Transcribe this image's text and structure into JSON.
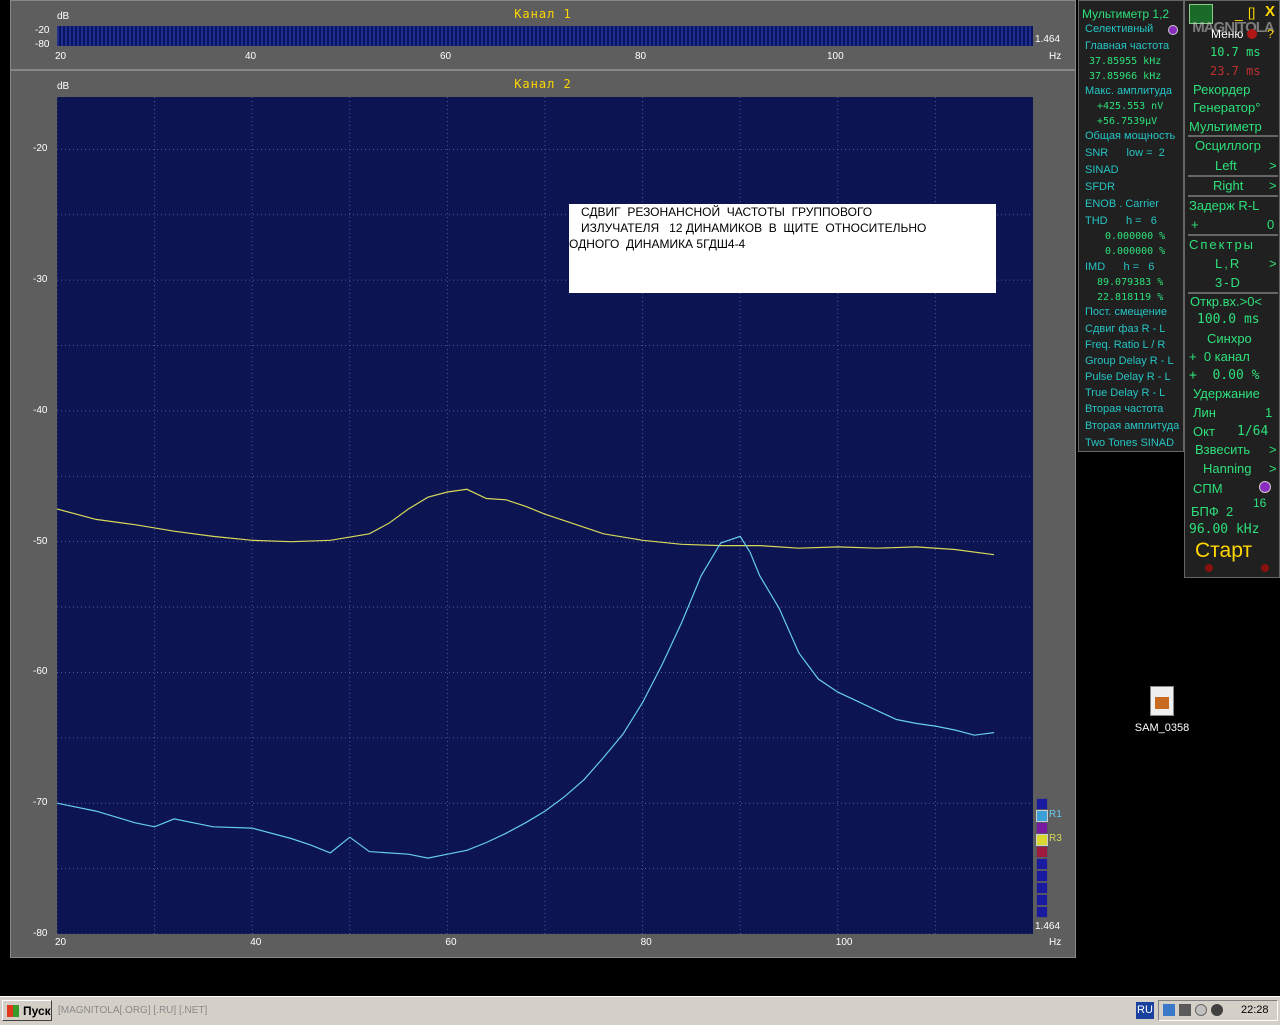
{
  "channel1": {
    "title": "Канал 1",
    "db_label": "dB",
    "y_ticks": [
      "-20",
      "-80"
    ],
    "x_ticks": [
      "20",
      "40",
      "60",
      "80",
      "100"
    ],
    "x_unit": "Hz",
    "scale_value": "1.464"
  },
  "channel2": {
    "title": "Канал 2",
    "db_label": "dB",
    "scale_value": "1.464",
    "annotation": [
      "СДВИГ  РЕЗОНАНСНОЙ  ЧАСТОТЫ  ГРУППОВОГО",
      "ИЗЛУЧАТЕЛЯ   12 ДИНАМИКОВ  В  ЩИТЕ  ОТНОСИТЕЛЬНО",
      "ОДНОГО  ДИНАМИКА 5ГДШ4-4"
    ],
    "legend_labels": [
      "R1",
      "R3"
    ]
  },
  "chart_data": {
    "type": "line",
    "xlabel": "Hz",
    "ylabel": "dB",
    "xlim": [
      20,
      118
    ],
    "ylim": [
      -80,
      -16
    ],
    "x_ticks": [
      20,
      40,
      60,
      80,
      100
    ],
    "y_ticks": [
      -20,
      -30,
      -40,
      -50,
      -60,
      -70,
      -80
    ],
    "grid": true,
    "series": [
      {
        "name": "R3",
        "color": "#d8d85a",
        "x": [
          20,
          24,
          28,
          32,
          36,
          40,
          44,
          48,
          52,
          54,
          56,
          58,
          60,
          62,
          64,
          66,
          68,
          70,
          72,
          76,
          80,
          84,
          88,
          92,
          96,
          100,
          104,
          108,
          112,
          116
        ],
        "y": [
          -47.5,
          -48.3,
          -48.7,
          -49.2,
          -49.6,
          -49.9,
          -50.0,
          -49.9,
          -49.4,
          -48.6,
          -47.5,
          -46.6,
          -46.2,
          -46.0,
          -46.7,
          -46.8,
          -47.3,
          -47.9,
          -48.4,
          -49.4,
          -49.9,
          -50.2,
          -50.3,
          -50.3,
          -50.5,
          -50.4,
          -50.5,
          -50.4,
          -50.6,
          -51.0
        ]
      },
      {
        "name": "R1",
        "color": "#66ccf0",
        "x": [
          20,
          24,
          28,
          30,
          32,
          36,
          40,
          44,
          46,
          48,
          50,
          52,
          56,
          58,
          60,
          62,
          64,
          66,
          68,
          70,
          72,
          74,
          76,
          78,
          80,
          82,
          84,
          86,
          88,
          90,
          91,
          92,
          94,
          96,
          98,
          100,
          102,
          104,
          106,
          108,
          110,
          112,
          114,
          116
        ],
        "y": [
          -70.0,
          -70.6,
          -71.5,
          -71.8,
          -71.2,
          -71.8,
          -71.9,
          -72.7,
          -73.2,
          -73.8,
          -72.6,
          -73.7,
          -73.9,
          -74.2,
          -73.9,
          -73.6,
          -73.0,
          -72.3,
          -71.5,
          -70.6,
          -69.5,
          -68.2,
          -66.5,
          -64.7,
          -62.3,
          -59.4,
          -56.2,
          -52.6,
          -50.1,
          -49.6,
          -50.8,
          -52.6,
          -55.1,
          -58.5,
          -60.5,
          -61.5,
          -62.2,
          -62.9,
          -63.6,
          -63.9,
          -64.1,
          -64.4,
          -64.8,
          -64.6
        ]
      }
    ]
  },
  "multimeter": {
    "title": "Мультиметр 1,2",
    "rows": [
      {
        "label": "Селективный"
      },
      {
        "label": "Главная частота",
        "values": [
          "37.85955 kHz",
          "37.85966 kHz"
        ]
      },
      {
        "label": "Макс. амплитуда",
        "values": [
          "+425.553 nV",
          "+56.7539μV"
        ]
      },
      {
        "label": "Общая мощность"
      },
      {
        "label": "SNR      low =  2"
      },
      {
        "label": "SINAD"
      },
      {
        "label": "SFDR"
      },
      {
        "label": "ENOB . Carrier"
      },
      {
        "label": "THD      h =   6",
        "values": [
          "0.000000 %",
          "0.000000 %"
        ]
      },
      {
        "label": "IMD      h =   6",
        "values": [
          "89.079383 %",
          "22.818119 %"
        ]
      },
      {
        "label": "Пост. смещение"
      },
      {
        "label": "Сдвиг фаз R - L"
      },
      {
        "label": "Freq. Ratio  L / R"
      },
      {
        "label": "Group Delay R - L"
      },
      {
        "label": "Pulse Delay R - L"
      },
      {
        "label": "True Delay R - L"
      },
      {
        "label": "Вторая частота"
      },
      {
        "label": "Вторая амплитуда"
      },
      {
        "label": "Two Tones SINAD"
      }
    ]
  },
  "control_panel": {
    "logo": "MAGNITOLA",
    "menu_label": "Меню",
    "help_label": "?",
    "min_label": "_",
    "restore_label": "[]",
    "close_label": "X",
    "time1": "10.7 ms",
    "time2": "23.7 ms",
    "items": {
      "recorder": "Рекордер",
      "generator": "Генератор°",
      "multimeter": "Мультиметр",
      "oscillograph": "Осциллогр",
      "left": "Left",
      "right": "Right",
      "delay": "Задерж R-L",
      "delay_plus": "+",
      "delay_value": "0",
      "spectra": "Спектры",
      "lr": "L,R",
      "three_d": "3-D",
      "open_input": "Откр.вх.>0<",
      "open_input_value": "100.0 ms",
      "sync": "Синхро",
      "sync_channel": "+  0 канал",
      "sync_percent": "+  0.00 %",
      "hold": "Удержание",
      "lin": "Лин",
      "lin_value": "1",
      "oct": "Окт",
      "oct_value": "1/64",
      "weigh": "Взвесить",
      "hanning": "Hanning",
      "spm": "СПМ",
      "fft": "БПФ  2",
      "fft_exp": "16",
      "sample_rate": "96.00 kHz",
      "start": "Старт",
      "arrow": ">"
    }
  },
  "desktop_icon": {
    "label": "SAM_0358"
  },
  "taskbar": {
    "start_label": "Пуск",
    "background_text": "[MAGNITOLA[.ORG] [.RU] [.NET]",
    "lang": "RU",
    "time": "22:28"
  }
}
